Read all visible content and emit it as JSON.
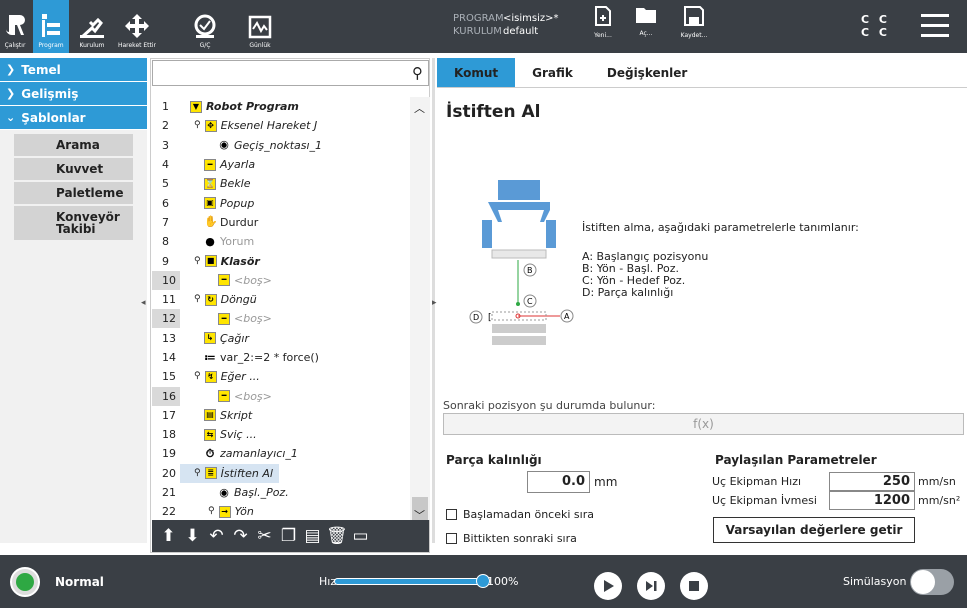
{
  "topbar": {
    "nav": [
      {
        "label": "Çalıştır",
        "icon": "ur-logo-icon"
      },
      {
        "label": "Program",
        "icon": "program-icon",
        "active": true
      },
      {
        "label": "Kurulum",
        "icon": "installation-icon"
      },
      {
        "label": "Hareket Ettir",
        "icon": "move-icon"
      },
      {
        "label": "G/Ç",
        "icon": "io-icon"
      },
      {
        "label": "Günlük",
        "icon": "log-icon"
      }
    ],
    "program_key": "PROGRAM",
    "program_value": "<isimsiz>*",
    "installation_key": "KURULUM",
    "installation_value": "default",
    "file_buttons": [
      {
        "label": "Yeni...",
        "icon": "new-file-icon"
      },
      {
        "label": "Aç...",
        "icon": "folder-icon"
      },
      {
        "label": "Kaydet...",
        "icon": "save-icon"
      }
    ],
    "cc_line1": "C C",
    "cc_line2": "C C"
  },
  "sidebar": {
    "categories": [
      {
        "label": "Temel",
        "chevron": ">"
      },
      {
        "label": "Gelişmiş",
        "chevron": ">"
      },
      {
        "label": "Şablonlar",
        "chevron": "v"
      }
    ],
    "items": [
      "Arama",
      "Kuvvet",
      "Paletleme",
      "Konveyör Takibi"
    ]
  },
  "tree": {
    "rows": [
      {
        "n": "1",
        "icon": "▼",
        "text": "Robot Program",
        "style": "bold-it",
        "indent": 0
      },
      {
        "n": "2",
        "icon": "✥",
        "text": "Eksenel Hareket J",
        "style": "it",
        "indent": 1,
        "pin": true
      },
      {
        "n": "3",
        "icon": "◉",
        "text": "Geçiş_noktası_1",
        "style": "it",
        "indent": 2,
        "plainicon": true
      },
      {
        "n": "4",
        "icon": "━",
        "text": "Ayarla",
        "style": "it",
        "indent": 1
      },
      {
        "n": "5",
        "icon": "⌛",
        "text": "Bekle",
        "style": "it",
        "indent": 1
      },
      {
        "n": "6",
        "icon": "▣",
        "text": "Popup",
        "style": "it",
        "indent": 1
      },
      {
        "n": "7",
        "icon": "✋",
        "text": "Durdur",
        "style": "",
        "indent": 1,
        "plainicon": true
      },
      {
        "n": "8",
        "icon": "●",
        "text": "Yorum",
        "style": "grey",
        "indent": 1,
        "plainicon": true
      },
      {
        "n": "9",
        "icon": "■",
        "text": "Klasör",
        "style": "bold-it",
        "indent": 1,
        "pin": true
      },
      {
        "n": "10",
        "icon": "━",
        "text": "<boş>",
        "style": "grey it",
        "indent": 2,
        "shade": true
      },
      {
        "n": "11",
        "icon": "↻",
        "text": "Döngü",
        "style": "it",
        "indent": 1,
        "pin": true
      },
      {
        "n": "12",
        "icon": "━",
        "text": "<boş>",
        "style": "grey it",
        "indent": 2,
        "shade": true
      },
      {
        "n": "13",
        "icon": "↳",
        "text": "Çağır",
        "style": "it",
        "indent": 1
      },
      {
        "n": "14",
        "icon": "≔",
        "text": "var_2:=2 * force()",
        "style": "",
        "indent": 1,
        "plainicon": true
      },
      {
        "n": "15",
        "icon": "↯",
        "text": "Eğer ...",
        "style": "it",
        "indent": 1,
        "pin": true
      },
      {
        "n": "16",
        "icon": "━",
        "text": "<boş>",
        "style": "grey it",
        "indent": 2,
        "shade": true
      },
      {
        "n": "17",
        "icon": "▤",
        "text": "Skript",
        "style": "it",
        "indent": 1
      },
      {
        "n": "18",
        "icon": "⇆",
        "text": "Sviç ...",
        "style": "it",
        "indent": 1
      },
      {
        "n": "19",
        "icon": "⏱",
        "text": "zamanlayıcı_1",
        "style": "it",
        "indent": 1,
        "plainicon": true
      },
      {
        "n": "20",
        "icon": "≣",
        "text": "İstiften Al",
        "style": "it",
        "indent": 1,
        "pin": true,
        "selected": true
      },
      {
        "n": "21",
        "icon": "◉",
        "text": "Başl._Poz.",
        "style": "it",
        "indent": 2,
        "plainicon": true
      },
      {
        "n": "22",
        "icon": "→",
        "text": "Yön",
        "style": "it",
        "indent": 2,
        "pin": true
      }
    ],
    "toolbar_icons": [
      {
        "g": "⬆",
        "name": "move-up-icon"
      },
      {
        "g": "⬇",
        "name": "move-down-icon"
      },
      {
        "g": "↶",
        "name": "undo-icon"
      },
      {
        "g": "↷",
        "name": "redo-icon"
      },
      {
        "g": "✂",
        "name": "cut-icon"
      },
      {
        "g": "❐",
        "name": "copy-icon"
      },
      {
        "g": "▤",
        "name": "paste-icon"
      },
      {
        "g": "🗑",
        "name": "delete-icon"
      },
      {
        "g": "▭",
        "name": "suppress-icon"
      }
    ]
  },
  "tabs": [
    "Komut",
    "Grafik",
    "Değişkenler"
  ],
  "panel": {
    "title": "İstiften Al",
    "description": "İstiften alma, aşağıdaki parametrelerle tanımlanır:",
    "legend": [
      "A: Başlangıç pozisyonu",
      "B: Yön - Başl. Poz.",
      "C: Yön - Hedef Poz.",
      "D: Parça kalınlığı"
    ],
    "diagram_labels": {
      "a": "A",
      "b": "B",
      "c": "C",
      "d": "D"
    },
    "next_label": "Sonraki pozisyon şu durumda bulunur:",
    "next_placeholder": "f(x)",
    "thickness_label": "Parça kalınlığı",
    "thickness_value": "0.0",
    "thickness_unit": "mm",
    "checkbox_before": "Başlamadan önceki sıra",
    "checkbox_after": "Bittikten sonraki sıra",
    "shared_title": "Paylaşılan Parametreler",
    "tool_speed_label": "Uç Ekipman Hızı",
    "tool_speed_value": "250",
    "tool_speed_unit": "mm/sn",
    "tool_accel_label": "Uç Ekipman İvmesi",
    "tool_accel_value": "1200",
    "tool_accel_unit": "mm/sn²",
    "reset_label": "Varsayılan değerlere getir"
  },
  "bottombar": {
    "status": "Normal",
    "speed_label": "Hız",
    "speed_value": "100%",
    "speed_fraction": 1.0,
    "sim_label": "Simülasyon"
  }
}
